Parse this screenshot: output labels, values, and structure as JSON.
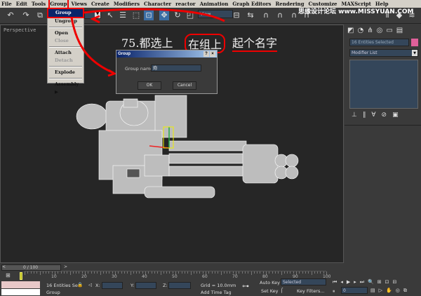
{
  "menubar": [
    "File",
    "Edit",
    "Tools",
    "Group",
    "Views",
    "Create",
    "Modifiers",
    "Character",
    "reactor",
    "Animation",
    "Graph Editors",
    "Rendering",
    "Customize",
    "MAXScript",
    "Help"
  ],
  "watermark": "思缘设计论坛 www.MISSYUAN.COM",
  "toolbar": {
    "view_dropdown": "View"
  },
  "group_menu": {
    "items": [
      {
        "label": "Group",
        "state": "selected"
      },
      {
        "label": "Ungroup"
      },
      {
        "label": "Open"
      },
      {
        "label": "Close",
        "state": "disabled"
      },
      {
        "label": "Attach"
      },
      {
        "label": "Detach",
        "state": "disabled"
      },
      {
        "label": "Explode"
      },
      {
        "label": "Assembly"
      }
    ]
  },
  "viewport": {
    "label": "Perspective",
    "caption": {
      "step": "75.都选上",
      "middle": "在组上",
      "end": "起个名字"
    }
  },
  "dialog": {
    "title": "Group",
    "name_label": "Group name:",
    "name_value": "炮",
    "ok": "OK",
    "cancel": "Cancel"
  },
  "command_panel": {
    "selection": "16 Entities Selected",
    "modifier_list": "Modifier List",
    "color": "#e0609a"
  },
  "timeline": {
    "frame": "0 / 100",
    "ticks": [
      "10",
      "20",
      "30",
      "40",
      "50",
      "60",
      "70",
      "80",
      "90",
      "100"
    ]
  },
  "status": {
    "selection": "16 Entities Se",
    "x_label": "X:",
    "y_label": "Y:",
    "z_label": "Z:",
    "grid": "Grid = 10.0mm",
    "prompt": "Group",
    "add_time_tag": "Add Time Tag",
    "auto_key": "Auto Key",
    "set_key": "Set Key",
    "key_mode": "Selected",
    "key_filters": "Key Filters...",
    "current_frame": "0"
  }
}
